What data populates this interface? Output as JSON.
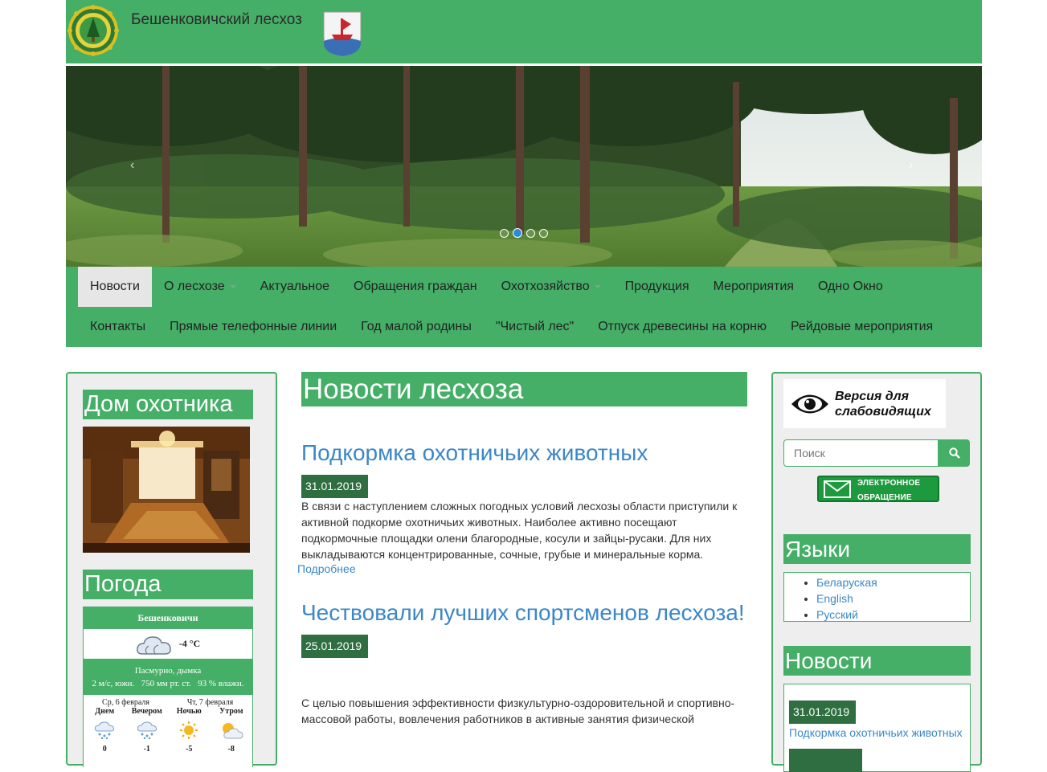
{
  "header": {
    "title": "Бешенковичский лесхоз",
    "colors": {
      "brand_green": "#45ae67",
      "link_blue": "#3b87c8",
      "date_green": "#2f6e40"
    }
  },
  "slider": {
    "prev_icon": "chevron-left-icon",
    "next_icon": "chevron-right-icon",
    "active_index": 1,
    "count": 4
  },
  "nav": {
    "row1": [
      "Новости",
      "О лесхозе",
      "Актуальное",
      "Обращения граждан",
      "Охотхозяйство",
      "Продукция",
      "Мероприятия",
      "Одно Окно"
    ],
    "row2": [
      "Контакты",
      "Прямые телефонные линии",
      "Год малой родины",
      "\"Чистый лес\"",
      "Отпуск древесины на корню",
      "Рейдовые мероприятия"
    ]
  },
  "left": {
    "hunter_title": "Дом охотника",
    "weather_title": "Погода",
    "weather": {
      "city": "Бешенковичи",
      "temp_now": "-4 °C",
      "desc": "Пасмурно, дымка",
      "details": "2 м/с, южн.   750 мм рт. ст.   93 % влажн.",
      "day1": "Ср, 6 февраля",
      "day2": "Чт, 7 февраля",
      "parts": [
        {
          "label": "Днем",
          "temp": "0",
          "icon": "snow-cloud-icon"
        },
        {
          "label": "Вечером",
          "temp": "-1",
          "icon": "snow-cloud-icon"
        },
        {
          "label": "Ночью",
          "temp": "-5",
          "icon": "sun-icon"
        },
        {
          "label": "Утром",
          "temp": "-8",
          "icon": "sun-cloud-icon"
        }
      ]
    }
  },
  "main": {
    "page_title": "Новости лесхоза",
    "news": [
      {
        "title": "Подкормка охотничьих животных",
        "date": "31.01.2019",
        "text": "В связи с наступлением сложных погодных условий лесхозы области приступили к активной подкорме охотничьих животных. Наиболее активно посещают подкормочные площадки олени благородные, косули и зайцы-русаки. Для них выкладываются концентрированные, сочные, грубые и минеральные корма.",
        "more": "Подробнее"
      },
      {
        "title": "Чествовали лучших спортсменов лесхоза!",
        "date": "25.01.2019",
        "text": "С целью повышения эффективности физкультурно-оздоровительной и спортивно-массовой работы, вовлечения работников в активные занятия физической"
      }
    ]
  },
  "right": {
    "accessibility_label_1": "Версия для",
    "accessibility_label_2": "слабовидящих",
    "search_placeholder": "Поиск",
    "eapp_line1": "ЭЛЕКТРОННОЕ",
    "eapp_line2": "ОБРАЩЕНИЕ",
    "languages_title": "Языки",
    "languages": [
      "Беларуская",
      "English",
      "Русский"
    ],
    "news_title": "Новости",
    "news_date": "31.01.2019",
    "news_link": "Подкормка охотничьих животных"
  }
}
